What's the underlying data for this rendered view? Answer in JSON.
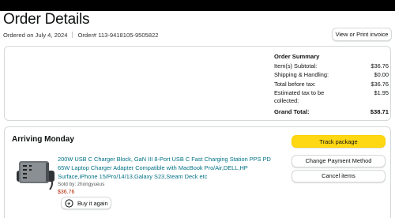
{
  "header": {
    "title": "Order Details",
    "ordered_on": "Ordered on July 4, 2024",
    "order_number": "Order# 113-9418105-9505822",
    "invoice_button": "View or Print invoice"
  },
  "summary": {
    "title": "Order Summary",
    "rows": [
      {
        "label": "Item(s) Subtotal:",
        "value": "$36.76"
      },
      {
        "label": "Shipping & Handling:",
        "value": "$0.00"
      },
      {
        "label": "Total before tax:",
        "value": "$36.76"
      },
      {
        "label_line1": "Estimated tax to be",
        "label_line2": "collected:",
        "value": "$1.95"
      }
    ],
    "grand_total_label": "Grand Total:",
    "grand_total_value": "$38.71"
  },
  "shipment": {
    "status": "Arriving Monday",
    "product": {
      "title": "200W USB C Charger Block, GaN III 8-Port USB C Fast Charging Station PPS PD 65W Laptop Charger Adapter Compatible with MacBook Pro/Air,DELL,HP Surface,iPhone 15/Pro/14/13,Galaxy S23,Steam Deck etc",
      "sold_by": "Sold by: zhongyueus",
      "price": "$36.76",
      "buy_again": "Buy it again"
    },
    "buttons": {
      "track": "Track package",
      "change_payment": "Change Payment Method",
      "cancel": "Cancel items"
    }
  },
  "colors": {
    "accent_yellow": "#ffd814",
    "link_teal": "#007185",
    "price_red": "#b12704"
  }
}
